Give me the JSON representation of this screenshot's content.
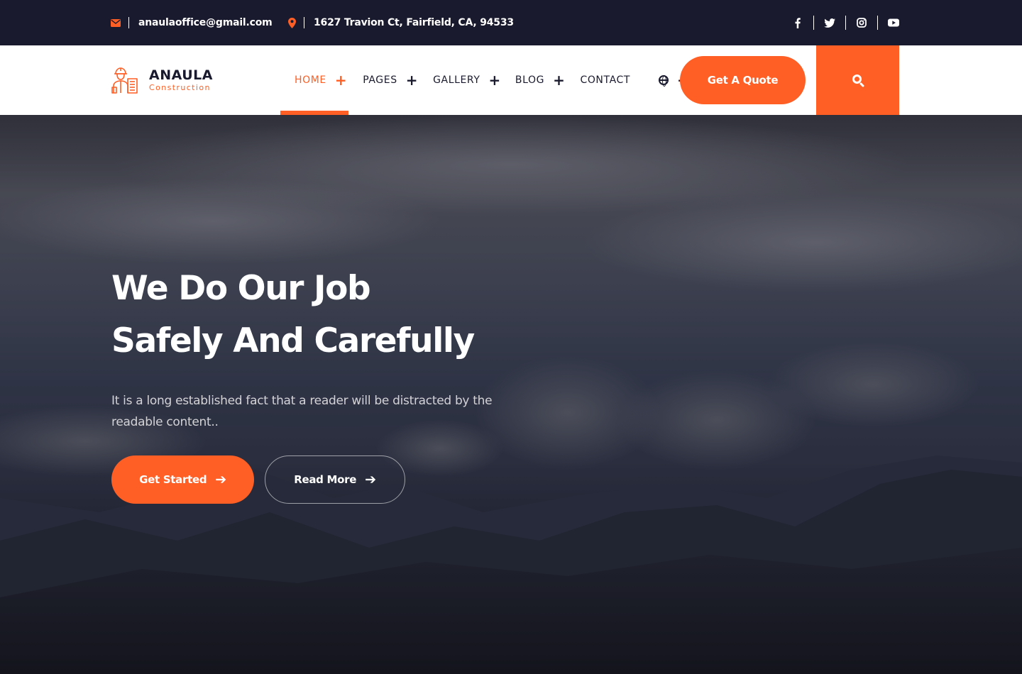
{
  "topbar": {
    "email": "anaulaoffice@gmail.com",
    "address": "1627 Travion Ct, Fairfield, CA, 94533",
    "social": [
      "facebook",
      "twitter",
      "instagram",
      "youtube"
    ]
  },
  "brand": {
    "name": "ANAULA",
    "tagline": "Construction"
  },
  "nav": {
    "items": [
      {
        "label": "HOME",
        "active": true,
        "has_submenu": true
      },
      {
        "label": "PAGES",
        "has_submenu": true
      },
      {
        "label": "GALLERY",
        "has_submenu": true
      },
      {
        "label": "BLOG",
        "has_submenu": true
      },
      {
        "label": "CONTACT",
        "has_submenu": false
      }
    ],
    "language_icon": "globe-icon",
    "quote_label": "Get A Quote"
  },
  "hero": {
    "title_line1": "We Do Our Job",
    "title_line2": "Safely And Carefully",
    "description": "It is a long established fact that a reader will be distracted by the readable content..",
    "primary_button": "Get Started",
    "secondary_button": "Read More"
  },
  "colors": {
    "accent": "#ff5e24",
    "dark": "#1a1a2e"
  }
}
